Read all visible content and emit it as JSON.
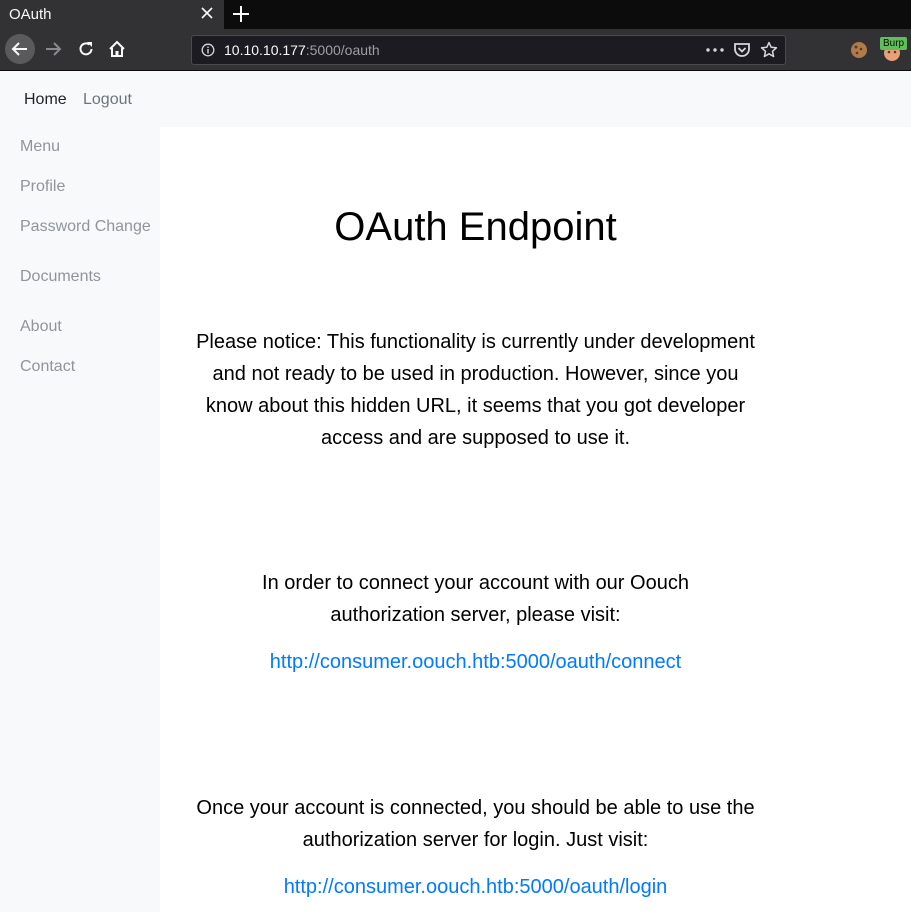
{
  "browser": {
    "tab_title": "OAuth",
    "url_host": "10.10.10.177",
    "url_path": ":5000/oauth",
    "extension_badge": "Burp"
  },
  "topnav": {
    "home": "Home",
    "logout": "Logout"
  },
  "sidebar": {
    "items": [
      {
        "label": "Menu"
      },
      {
        "label": "Profile"
      },
      {
        "label": "Password Change"
      },
      {
        "label": "Documents"
      },
      {
        "label": "About"
      },
      {
        "label": "Contact"
      }
    ]
  },
  "main": {
    "title": "OAuth Endpoint",
    "notice": "Please notice: This functionality is currently under development and not ready to be used in production. However, since you know about this hidden URL, it seems that you got developer access and are supposed to use it.",
    "connect_text": "In order to connect your account with our Oouch authorization server, please visit:",
    "connect_link": "http://consumer.oouch.htb:5000/oauth/connect",
    "login_text": "Once your account is connected, you should be able to use the authorization server for login. Just visit:",
    "login_link": "http://consumer.oouch.htb:5000/oauth/login"
  },
  "colors": {
    "link": "#007bff",
    "sidebar_bg": "#f8f9fa",
    "muted": "#8f959a",
    "chrome_bg": "#323234"
  }
}
